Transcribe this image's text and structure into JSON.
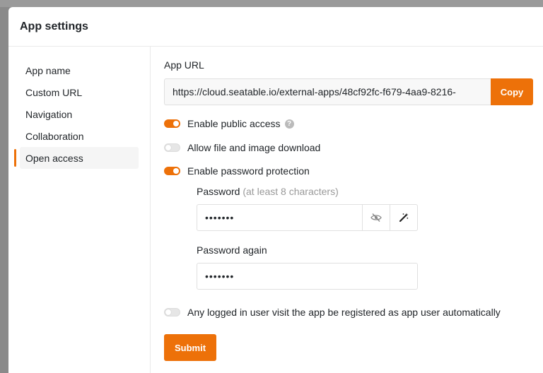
{
  "dialog": {
    "title": "App settings"
  },
  "sidebar": {
    "items": [
      {
        "label": "App name",
        "active": false
      },
      {
        "label": "Custom URL",
        "active": false
      },
      {
        "label": "Navigation",
        "active": false
      },
      {
        "label": "Collaboration",
        "active": false
      },
      {
        "label": "Open access",
        "active": true
      }
    ]
  },
  "app_url": {
    "label": "App URL",
    "value": "https://cloud.seatable.io/external-apps/48cf92fc-f679-4aa9-8216-",
    "copy_label": "Copy"
  },
  "toggles": {
    "public_access": {
      "label": "Enable public access",
      "on": true,
      "help_icon": "question-circle-icon"
    },
    "file_download": {
      "label": "Allow file and image download",
      "on": false
    },
    "password_protection": {
      "label": "Enable password protection",
      "on": true
    },
    "auto_register": {
      "label": "Any logged in user visit the app be registered as app user automatically",
      "on": false
    }
  },
  "password": {
    "label": "Password",
    "hint": "(at least 8 characters)",
    "value": "•••••••",
    "toggle_visibility_icon": "eye-slash-icon",
    "generate_icon": "magic-wand-icon"
  },
  "password_again": {
    "label": "Password again",
    "value": "•••••••"
  },
  "submit_label": "Submit",
  "colors": {
    "accent": "#ed7109",
    "border": "#e0e0e0"
  }
}
